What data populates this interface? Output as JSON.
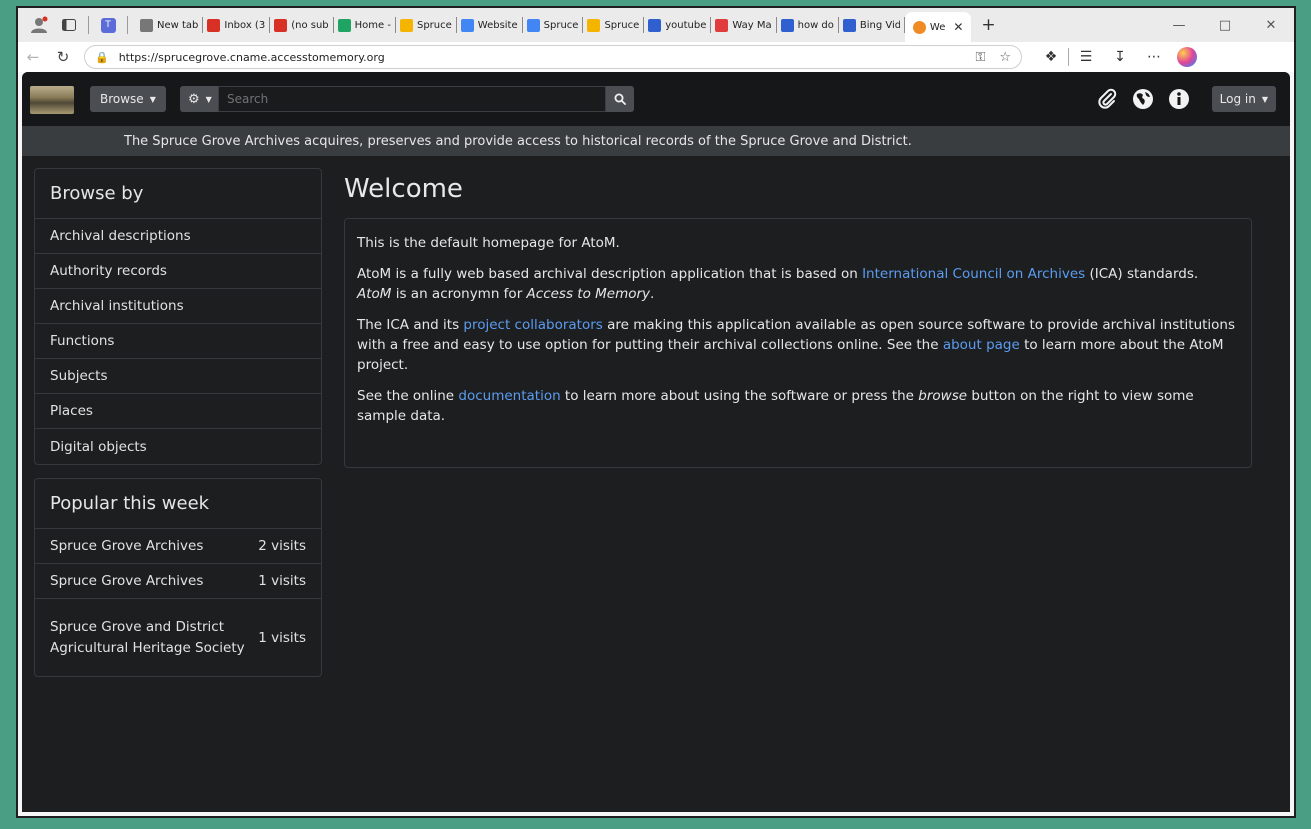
{
  "browser": {
    "tabs": [
      {
        "title": "New tab",
        "fav_color": "#777777"
      },
      {
        "title": "Inbox (3",
        "fav_color": "#d93025"
      },
      {
        "title": "(no sub",
        "fav_color": "#d93025"
      },
      {
        "title": "Home -",
        "fav_color": "#1fa463"
      },
      {
        "title": "Spruce",
        "fav_color": "#f4b400"
      },
      {
        "title": "Website",
        "fav_color": "#4285f4"
      },
      {
        "title": "Spruce",
        "fav_color": "#4285f4"
      },
      {
        "title": "Spruce",
        "fav_color": "#f4b400"
      },
      {
        "title": "youtube",
        "fav_color": "#3060d0"
      },
      {
        "title": "Way Ma",
        "fav_color": "#e03c3c"
      },
      {
        "title": "how do",
        "fav_color": "#3060d0"
      },
      {
        "title": "Bing Vid",
        "fav_color": "#3060d0"
      }
    ],
    "active_tab": {
      "title": "We",
      "fav_color": "#f08a24"
    },
    "url": "https://sprucegrove.cname.accesstomemory.org"
  },
  "site": {
    "browse_label": "Browse",
    "search_placeholder": "Search",
    "login_label": "Log in",
    "banner": "The Spruce Grove Archives acquires, preserves and provide access to historical records of the Spruce Grove and District."
  },
  "sidebar": {
    "browse_title": "Browse by",
    "browse_items": [
      "Archival descriptions",
      "Authority records",
      "Archival institutions",
      "Functions",
      "Subjects",
      "Places",
      "Digital objects"
    ],
    "popular_title": "Popular this week",
    "popular_items": [
      {
        "title": "Spruce Grove Archives",
        "visits": "2 visits"
      },
      {
        "title": "Spruce Grove Archives",
        "visits": "1 visits"
      },
      {
        "title": "Spruce Grove and District Agricultural Heritage Society",
        "visits": "1 visits"
      }
    ]
  },
  "main": {
    "heading": "Welcome",
    "p1": "This is the default homepage for AtoM.",
    "p2_a": "AtoM is a fully web based archival description application that is based on ",
    "p2_link": "International Council on Archives",
    "p2_b": " (ICA) standards.",
    "p2_c": "AtoM",
    "p2_d": " is an acronymn for ",
    "p2_e": "Access to Memory",
    "p2_f": ".",
    "p3_a": "The ICA and its ",
    "p3_link1": "project collaborators",
    "p3_b": " are making this application available as open source software to provide archival institutions with a free and easy to use option for putting their archival collections online. See the ",
    "p3_link2": "about page",
    "p3_c": " to learn more about the AtoM project.",
    "p4_a": "See the online ",
    "p4_link": "documentation",
    "p4_b": " to learn more about using the software or press the ",
    "p4_c": "browse",
    "p4_d": " button on the right to view some sample data."
  }
}
